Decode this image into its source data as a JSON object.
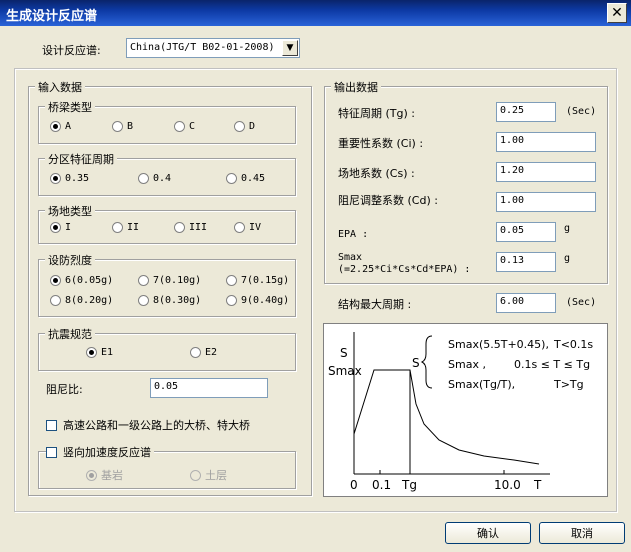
{
  "window": {
    "title": "生成设计反应谱",
    "close_glyph": "✕"
  },
  "spectrum": {
    "label": "设计反应谱:",
    "value": "China(JTG/T B02-01-2008)",
    "arrow": "▼"
  },
  "input": {
    "legend": "输入数据",
    "bridge_type": {
      "legend": "桥梁类型",
      "options": [
        "A",
        "B",
        "C",
        "D"
      ],
      "selected": 0
    },
    "period": {
      "legend": "分区特征周期",
      "options": [
        "0.35",
        "0.4",
        "0.45"
      ],
      "selected": 0
    },
    "site": {
      "legend": "场地类型",
      "options": [
        "I",
        "II",
        "III",
        "IV"
      ],
      "selected": 0
    },
    "intensity": {
      "legend": "设防烈度",
      "options": [
        "6(0.05g)",
        "7(0.10g)",
        "7(0.15g)",
        "8(0.20g)",
        "8(0.30g)",
        "9(0.40g)"
      ],
      "selected": 0
    },
    "code": {
      "legend": "抗震规范",
      "options": [
        "E1",
        "E2"
      ],
      "selected": 0
    },
    "damping": {
      "label": "阻尼比:",
      "value": "0.05"
    },
    "highway_check": "高速公路和一级公路上的大桥、特大桥",
    "vertical_check": "竖向加速度反应谱",
    "vertical_options": [
      "基岩",
      "土层"
    ]
  },
  "output": {
    "legend": "输出数据",
    "tg": {
      "label": "特征周期 (Tg) :",
      "value": "0.25",
      "unit": "(Sec)"
    },
    "ci": {
      "label": "重要性系数 (Ci) :",
      "value": "1.00"
    },
    "cs": {
      "label": "场地系数 (Cs) :",
      "value": "1.20"
    },
    "cd": {
      "label": "阻尼调整系数 (Cd) :",
      "value": "1.00"
    },
    "epa": {
      "label": "EPA :",
      "value": "0.05",
      "unit": "g"
    },
    "smax": {
      "label": "Smax",
      "sublabel": "(=2.25*Ci*Cs*Cd*EPA) :",
      "value": "0.13",
      "unit": "g"
    }
  },
  "max_period": {
    "label": "结构最大周期 :",
    "value": "6.00",
    "unit": "(Sec)"
  },
  "diagram": {
    "y_label": "S",
    "y_smax": "Smax",
    "x_ticks": [
      "0",
      "0.1",
      "Tg",
      "10.0",
      "T"
    ],
    "formula_s": "S",
    "formula1": "Smax(5.5T+0.45),",
    "cond1": "T<0.1s",
    "formula2": "Smax ,",
    "cond2": "0.1s ≤ T ≤ Tg",
    "formula3": "Smax(Tg/T),",
    "cond3": "T>Tg"
  },
  "buttons": {
    "ok": "确认",
    "cancel": "取消"
  }
}
